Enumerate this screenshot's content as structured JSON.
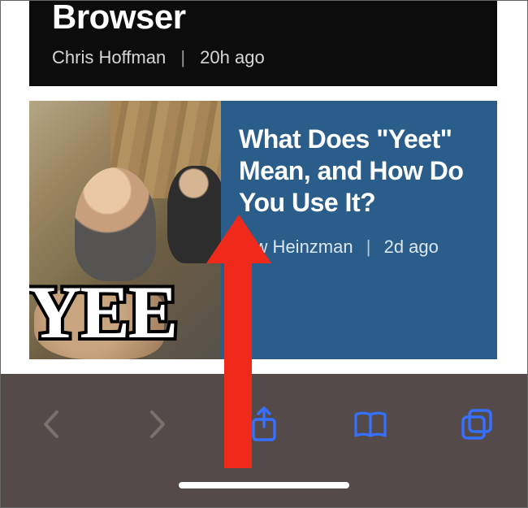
{
  "header": {
    "title": "Browser",
    "author": "Chris Hoffman",
    "separator": "|",
    "timestamp": "20h ago"
  },
  "article": {
    "title": "What Does \"Yeet\" Mean, and How Do You Use It?",
    "author_visible": "rew Heinzman",
    "separator": "|",
    "timestamp": "2d ago",
    "thumb_overlay_text": "YEE"
  },
  "toolbar": {
    "icons": {
      "back": "chevron-left-icon",
      "forward": "chevron-right-icon",
      "share": "share-icon",
      "bookmarks": "book-icon",
      "tabs": "tabs-icon"
    },
    "colors": {
      "active": "#3670ff",
      "inactive": "#78726f"
    }
  }
}
